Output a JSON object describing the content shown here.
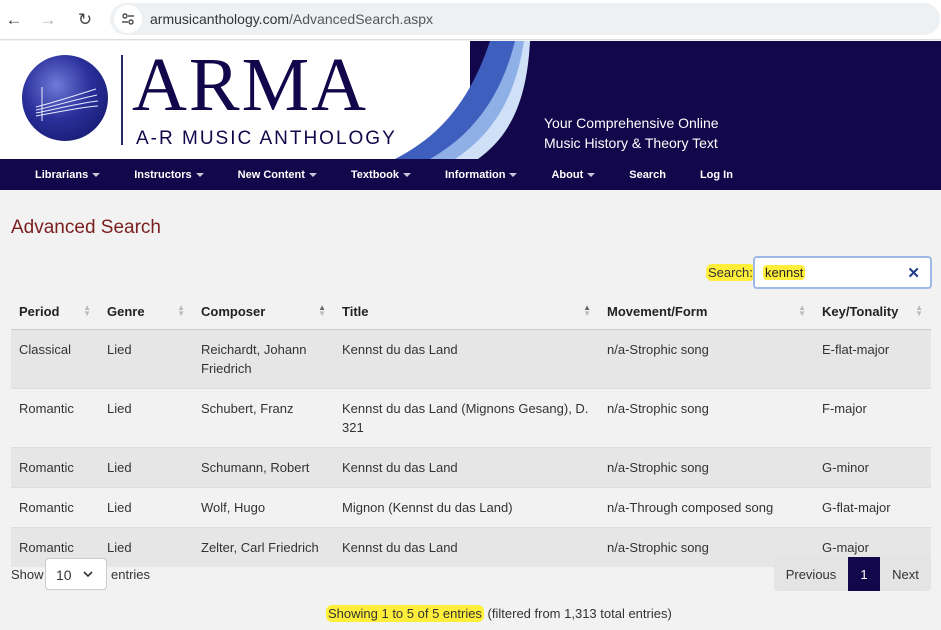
{
  "browser": {
    "url_domain": "armusicanthology.com",
    "url_path": "/AdvancedSearch.aspx"
  },
  "banner": {
    "logo_title": "ARMA",
    "logo_subtitle": "A-R MUSIC ANTHOLOGY",
    "tagline_line1": "Your Comprehensive Online",
    "tagline_line2": "Music History & Theory Text"
  },
  "menu": {
    "items": [
      {
        "label": "Librarians",
        "dropdown": true
      },
      {
        "label": "Instructors",
        "dropdown": true
      },
      {
        "label": "New Content",
        "dropdown": true
      },
      {
        "label": "Textbook",
        "dropdown": true
      },
      {
        "label": "Information",
        "dropdown": true
      },
      {
        "label": "About",
        "dropdown": true
      },
      {
        "label": "Search",
        "dropdown": false
      },
      {
        "label": "Log In",
        "dropdown": false
      }
    ]
  },
  "page": {
    "title": "Advanced Search"
  },
  "search": {
    "label": "Search:",
    "value": "kennst",
    "clear": "✕"
  },
  "table": {
    "columns": [
      "Period",
      "Genre",
      "Composer",
      "Title",
      "Movement/Form",
      "Key/Tonality"
    ],
    "rows": [
      [
        "Classical",
        "Lied",
        "Reichardt, Johann Friedrich",
        "Kennst du das Land",
        "n/a-Strophic song",
        "E-flat-major"
      ],
      [
        "Romantic",
        "Lied",
        "Schubert, Franz",
        "Kennst du das Land (Mignons Gesang), D. 321",
        "n/a-Strophic song",
        "F-major"
      ],
      [
        "Romantic",
        "Lied",
        "Schumann, Robert",
        "Kennst du das Land",
        "n/a-Strophic song",
        "G-minor"
      ],
      [
        "Romantic",
        "Lied",
        "Wolf, Hugo",
        "Mignon (Kennst du das Land)",
        "n/a-Through composed song",
        "G-flat-major"
      ],
      [
        "Romantic",
        "Lied",
        "Zelter, Carl Friedrich",
        "Kennst du das Land",
        "n/a-Strophic song",
        "G-major"
      ]
    ]
  },
  "length": {
    "show_label": "Show",
    "value": "10",
    "entries_label": "entries"
  },
  "pager": {
    "prev": "Previous",
    "current": "1",
    "next": "Next"
  },
  "info": {
    "main": "Showing 1 to 5 of 5 entries",
    "filtered": " (filtered from 1,313 total entries)"
  },
  "colors": {
    "brand_navy": "#11074a",
    "title_maroon": "#7a1f1f",
    "highlight": "#ffef3a"
  }
}
